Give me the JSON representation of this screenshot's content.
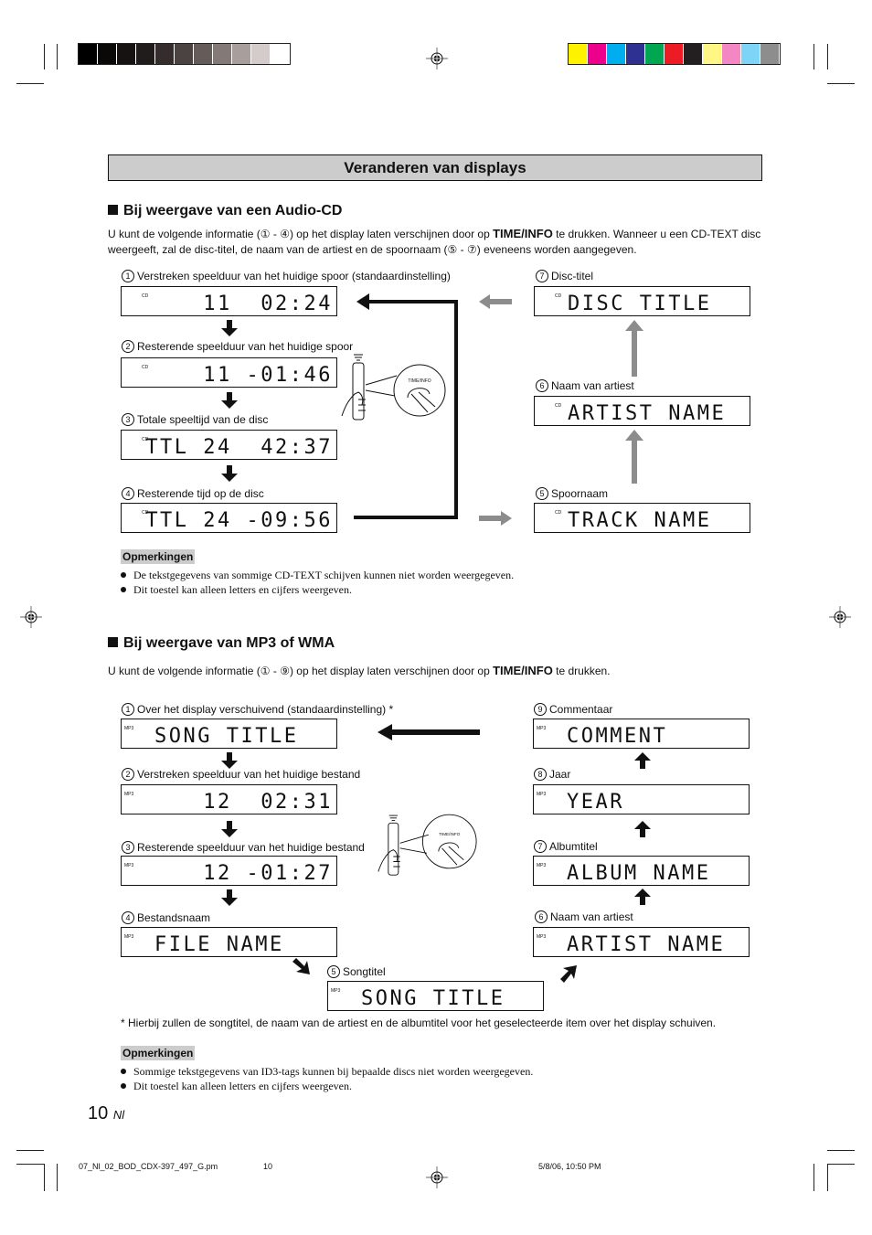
{
  "color_bars": {
    "grayscale": [
      "#000000",
      "#0a0908",
      "#151211",
      "#201c1b",
      "#342d2b",
      "#4b4341",
      "#655b58",
      "#837a78",
      "#a89e9c",
      "#d3cccb",
      "#ffffff"
    ],
    "colors": [
      "#fff200",
      "#ec008c",
      "#00aeef",
      "#2e3192",
      "#00a651",
      "#ed1c24",
      "#231f20",
      "#fff685",
      "#f287c3",
      "#7dd4f7",
      "#8d8d8d"
    ]
  },
  "page_title": "Veranderen van displays",
  "section_cd": {
    "heading": "Bij weergave van een Audio-CD",
    "intro_before": "U kunt de volgende informatie (",
    "intro_range": "① - ④",
    "intro_mid": ") op het display laten verschijnen door op ",
    "intro_key": "TIME/INFO",
    "intro_after": " te drukken. Wanneer u een CD-TEXT disc weergeeft, zal de disc-titel, de naam van de artiest en de spoornaam (",
    "intro_range2": "⑤ - ⑦",
    "intro_end": ") eveneens worden aangegeven.",
    "remote_button_label": "TIME/INFO",
    "displays": [
      {
        "num": "1",
        "label": "Verstreken speelduur van het huidige spoor (standaardinstelling)",
        "tag": "CD",
        "text": "11  02:24"
      },
      {
        "num": "2",
        "label": "Resterende speelduur van het huidige spoor",
        "tag": "CD",
        "text": "11 -01:46"
      },
      {
        "num": "3",
        "label": "Totale speeltijd van de disc",
        "tag": "CD",
        "text": "TTL 24  42:37"
      },
      {
        "num": "4",
        "label": "Resterende tijd op de disc",
        "tag": "CD",
        "text": "TTL 24 -09:56"
      },
      {
        "num": "5",
        "label": "Spoornaam",
        "tag": "CD",
        "text": "TRACK NAME"
      },
      {
        "num": "6",
        "label": "Naam van artiest",
        "tag": "CD",
        "text": "ARTIST NAME"
      },
      {
        "num": "7",
        "label": "Disc-titel",
        "tag": "CD",
        "text": "DISC TITLE"
      }
    ],
    "notes_heading": "Opmerkingen",
    "notes": [
      "De tekstgegevens van sommige CD-TEXT schijven kunnen niet worden weergegeven.",
      "Dit toestel kan alleen letters en cijfers weergeven."
    ]
  },
  "section_mp3": {
    "heading": "Bij weergave van MP3 of WMA",
    "intro_before": "U kunt de volgende informatie (",
    "intro_range": "① - ⑨",
    "intro_mid": ") op het display laten verschijnen door op ",
    "intro_key": "TIME/INFO",
    "intro_after": " te drukken.",
    "remote_button_label": "TIME/INFO",
    "displays": [
      {
        "num": "1",
        "label": "Over het display verschuivend (standaardinstelling)",
        "asterisk": "*",
        "tag": "MP3",
        "text": "SONG TITLE"
      },
      {
        "num": "2",
        "label": "Verstreken speelduur van het huidige bestand",
        "tag": "MP3",
        "text": "12  02:31"
      },
      {
        "num": "3",
        "label": "Resterende speelduur van het huidige bestand",
        "tag": "MP3",
        "text": "12 -01:27"
      },
      {
        "num": "4",
        "label": "Bestandsnaam",
        "tag": "MP3",
        "text": "FILE NAME"
      },
      {
        "num": "5",
        "label": "Songtitel",
        "tag": "MP3",
        "text": "SONG TITLE"
      },
      {
        "num": "6",
        "label": "Naam van artiest",
        "tag": "MP3",
        "text": "ARTIST NAME"
      },
      {
        "num": "7",
        "label": "Albumtitel",
        "tag": "MP3",
        "text": "ALBUM NAME"
      },
      {
        "num": "8",
        "label": "Jaar",
        "tag": "MP3",
        "text": "YEAR"
      },
      {
        "num": "9",
        "label": "Commentaar",
        "tag": "MP3",
        "text": "COMMENT"
      }
    ],
    "footnote": "* Hierbij zullen de songtitel, de naam van de artiest en de albumtitel voor het geselecteerde item over het display schuiven.",
    "notes_heading": "Opmerkingen",
    "notes": [
      "Sommige tekstgegevens van ID3-tags kunnen bij bepaalde discs niet worden weergegeven.",
      "Dit toestel kan alleen letters en cijfers weergeven."
    ]
  },
  "page_number": "10",
  "page_lang": "Nl",
  "footer": {
    "file": "07_Nl_02_BOD_CDX-397_497_G.pm",
    "page": "10",
    "date": "5/8/06, 10:50 PM"
  }
}
